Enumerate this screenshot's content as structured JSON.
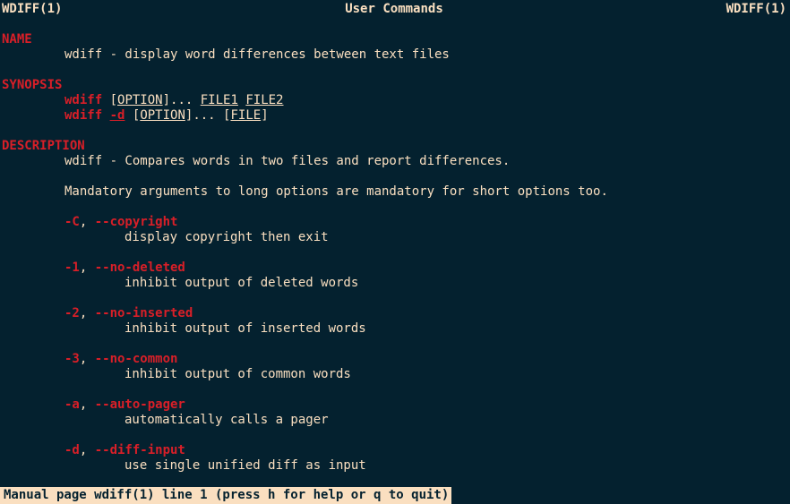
{
  "terminal": {
    "background_color": "#04212f",
    "foreground_color": "#fadfc0",
    "accent_color": "#d81f28",
    "status_bg_color": "#fadfc0",
    "status_fg_color": "#04212f"
  },
  "header": {
    "left": "WDIFF(1)",
    "center": "User Commands",
    "right": "WDIFF(1)"
  },
  "sections": {
    "name": {
      "heading": "NAME",
      "body": "wdiff - display word differences between text files"
    },
    "synopsis": {
      "heading": "SYNOPSIS",
      "line1": {
        "cmd": "wdiff",
        "open_bracket": " [",
        "option": "OPTION",
        "close_bracket": "]... ",
        "file1": "FILE1",
        "space": " ",
        "file2": "FILE2"
      },
      "line2": {
        "cmd": "wdiff",
        "space1": " ",
        "flag": "-d",
        "open_bracket": " [",
        "option": "OPTION",
        "close_bracket": "]... [",
        "file": "FILE",
        "end_bracket": "]"
      }
    },
    "description": {
      "heading": "DESCRIPTION",
      "body": "wdiff - Compares words in two files and report differences.",
      "note": "Mandatory arguments to long options are mandatory for short options too.",
      "options": [
        {
          "short": "-C",
          "separator": ", ",
          "long": "--copyright",
          "description": "display copyright then exit"
        },
        {
          "short": "-1",
          "separator": ", ",
          "long": "--no-deleted",
          "description": "inhibit output of deleted words"
        },
        {
          "short": "-2",
          "separator": ", ",
          "long": "--no-inserted",
          "description": "inhibit output of inserted words"
        },
        {
          "short": "-3",
          "separator": ", ",
          "long": "--no-common",
          "description": "inhibit output of common words"
        },
        {
          "short": "-a",
          "separator": ", ",
          "long": "--auto-pager",
          "description": "automatically calls a pager"
        },
        {
          "short": "-d",
          "separator": ", ",
          "long": "--diff-input",
          "description": "use single unified diff as input"
        }
      ]
    }
  },
  "statusbar": {
    "text": "Manual page wdiff(1) line 1 (press h for help or q to quit)"
  }
}
